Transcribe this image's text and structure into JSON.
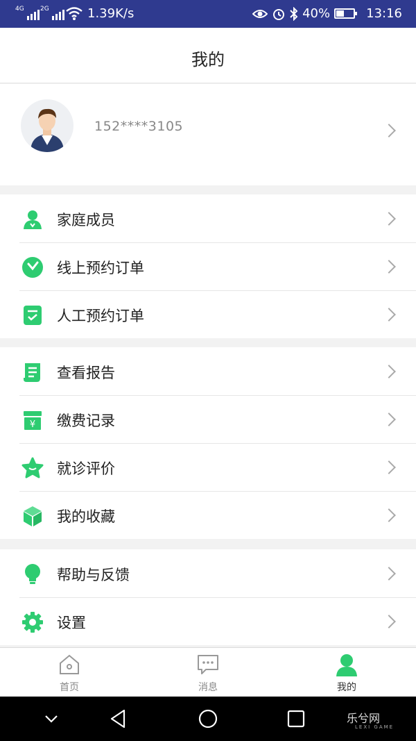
{
  "status_bar": {
    "network_1": "4G",
    "network_2": "2G",
    "speed": "1.39K/s",
    "battery": "40%",
    "battery_level": 0.4,
    "time": "13:16"
  },
  "header": {
    "title": "我的"
  },
  "profile": {
    "phone": "152****3105",
    "avatar_icon": "user-avatar"
  },
  "menu": {
    "group1": [
      {
        "label": "家庭成员",
        "icon": "family-icon"
      },
      {
        "label": "线上预约订单",
        "icon": "clock-icon"
      },
      {
        "label": "人工预约订单",
        "icon": "checklist-icon"
      }
    ],
    "group2": [
      {
        "label": "查看报告",
        "icon": "report-icon"
      },
      {
        "label": "缴费记录",
        "icon": "payment-icon"
      },
      {
        "label": "就诊评价",
        "icon": "star-icon"
      },
      {
        "label": "我的收藏",
        "icon": "box-icon"
      }
    ],
    "group3": [
      {
        "label": "帮助与反馈",
        "icon": "lightbulb-icon"
      },
      {
        "label": "设置",
        "icon": "gear-icon"
      }
    ]
  },
  "tabbar": {
    "tabs": [
      {
        "label": "首页",
        "icon": "home-icon"
      },
      {
        "label": "消息",
        "icon": "message-icon"
      },
      {
        "label": "我的",
        "icon": "person-icon",
        "active": true
      }
    ]
  },
  "colors": {
    "accent": "#2ecc71",
    "status_bar": "#2f3a8f"
  },
  "watermark": {
    "text": "乐兮网",
    "sub": "LEXI GAME"
  }
}
